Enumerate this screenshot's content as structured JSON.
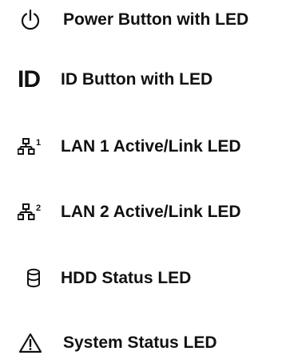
{
  "legend": {
    "items": [
      {
        "icon": "power-icon",
        "label": "Power Button with LED"
      },
      {
        "icon": "id-icon",
        "icon_text": "ID",
        "label": "ID Button with LED"
      },
      {
        "icon": "network-icon",
        "icon_text": "1",
        "label": "LAN 1 Active/Link LED"
      },
      {
        "icon": "network-icon",
        "icon_text": "2",
        "label": "LAN 2 Active/Link LED"
      },
      {
        "icon": "hdd-icon",
        "label": "HDD Status LED"
      },
      {
        "icon": "warning-icon",
        "label": "System Status LED"
      }
    ]
  }
}
